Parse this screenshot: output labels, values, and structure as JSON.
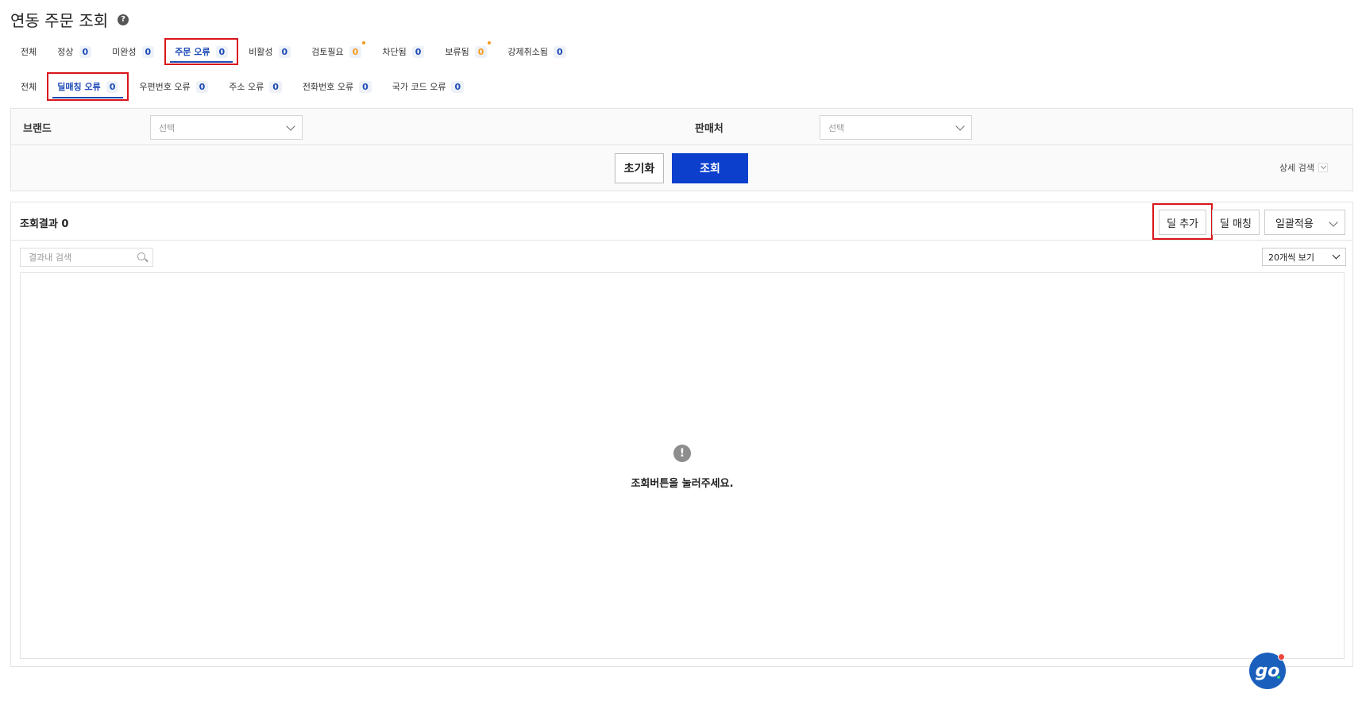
{
  "page": {
    "title": "연동 주문 조회",
    "help_icon": "question-circle-icon"
  },
  "main_tabs": [
    {
      "label": "전체",
      "count": null
    },
    {
      "label": "정상",
      "count": "0"
    },
    {
      "label": "미완성",
      "count": "0"
    },
    {
      "label": "주문 오류",
      "count": "0",
      "active": true,
      "highlighted": true
    },
    {
      "label": "비활성",
      "count": "0"
    },
    {
      "label": "검토필요",
      "count": "0",
      "count_color": "orange",
      "dot": true
    },
    {
      "label": "차단됨",
      "count": "0"
    },
    {
      "label": "보류됨",
      "count": "0",
      "count_color": "orange",
      "dot": true
    },
    {
      "label": "강제취소됨",
      "count": "0"
    }
  ],
  "sub_tabs": [
    {
      "label": "전체",
      "count": null
    },
    {
      "label": "딜매칭 오류",
      "count": "0",
      "active": true,
      "highlighted": true
    },
    {
      "label": "우편번호 오류",
      "count": "0"
    },
    {
      "label": "주소 오류",
      "count": "0"
    },
    {
      "label": "전화번호 오류",
      "count": "0"
    },
    {
      "label": "국가 코드 오류",
      "count": "0"
    }
  ],
  "filters": {
    "brand_label": "브랜드",
    "brand_placeholder": "선택",
    "seller_label": "판매처",
    "seller_placeholder": "선택"
  },
  "actions": {
    "reset_label": "초기화",
    "search_label": "조회",
    "detail_search_label": "상세 검색"
  },
  "results": {
    "title": "조회결과 0",
    "add_deal_label": "딜 추가",
    "deal_match_label": "딜 매칭",
    "bulk_apply_label": "일괄적용",
    "inner_search_placeholder": "결과내 검색",
    "page_size_label": "20개씩 보기",
    "empty_message": "조회버튼을 눌러주세요."
  },
  "colors": {
    "accent": "#1d4bb5",
    "primary_button": "#0b3fcc",
    "highlight_border": "#d9151b",
    "warning": "#f39a1d"
  },
  "float_button": {
    "label": "go",
    "icon": "chat-bot-icon"
  }
}
